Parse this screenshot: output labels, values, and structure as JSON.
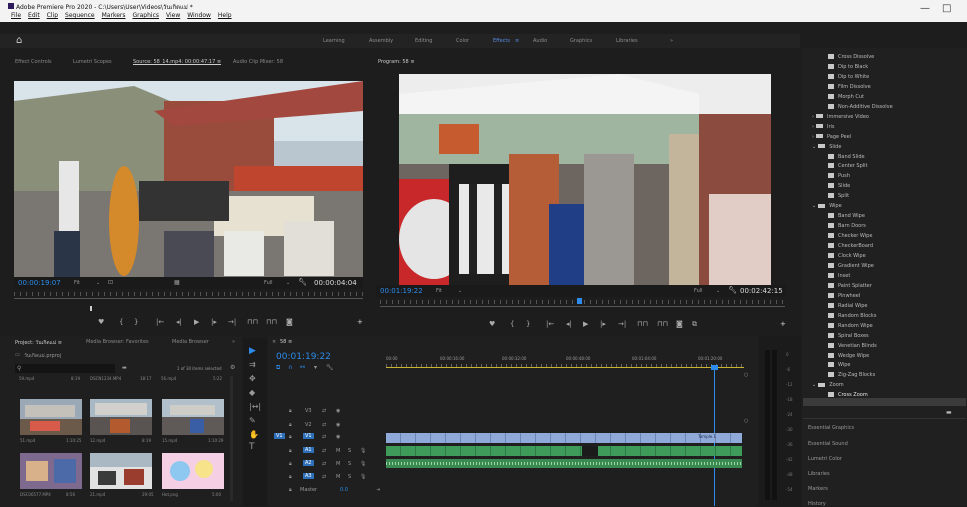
{
  "titlebar": {
    "title": "Adobe Premiere Pro 2020 - C:\\Users\\User\\Videos\\วันเกิดแม่ *",
    "menus": [
      "File",
      "Edit",
      "Clip",
      "Sequence",
      "Markers",
      "Graphics",
      "View",
      "Window",
      "Help"
    ],
    "minimize": "—",
    "restore": "□"
  },
  "header": {
    "home_icon": "home-icon",
    "workspaces": [
      "Learning",
      "Assembly",
      "Editing",
      "Color",
      "Effects",
      "Audio",
      "Graphics",
      "Libraries"
    ],
    "active_workspace": "Effects",
    "more": "»"
  },
  "source_monitor": {
    "tabs": [
      "Effect Controls",
      "Lumetri Scopes",
      "Source: 58_14.mp4: 00:00:47:17  ≡",
      "Audio Clip Mixer: 58"
    ],
    "timecode": "00:00:19:07",
    "fit": "Fit",
    "quality": "Full",
    "duration": "00:00:04:04"
  },
  "program_monitor": {
    "tab": "Program: 58  ≡",
    "timecode": "00:01:19:22",
    "fit": "Fit",
    "quality": "Full",
    "duration": "00:02:42:15"
  },
  "transport_icons": [
    "marker",
    "in-point",
    "out-point",
    "go-to-in",
    "step-back",
    "play",
    "step-forward",
    "go-to-out",
    "insert",
    "overwrite",
    "export-frame"
  ],
  "transport_glyphs": [
    "♥",
    "{",
    "}",
    "|←",
    "◂|",
    "▶",
    "|▸",
    "→|",
    "⊓⊓",
    "⊓⊓",
    "◙"
  ],
  "project_panel": {
    "tabs": [
      "Project: วันเกิดแม่ ≡",
      "Media Browser: Favorites",
      "Media Browser",
      "»"
    ],
    "project_file": "วันเกิดแม่.prproj",
    "items_selected": "1 of 30 items selected",
    "row1": [
      "59.mp4",
      "8:19",
      "DSCN1234.MP4",
      "18:17",
      "56.mp4",
      "5:22"
    ],
    "thumbs": [
      {
        "name": "51.mp4",
        "dur": "1:10:25"
      },
      {
        "name": "12.mp4",
        "dur": "8:19"
      },
      {
        "name": "15.mp4",
        "dur": "1:10:29"
      },
      {
        "name": "DSC06577.MP4",
        "dur": "8:56"
      },
      {
        "name": "21.mp4",
        "dur": "29:05"
      },
      {
        "name": "Hot.png",
        "dur": "5:00"
      }
    ]
  },
  "timeline": {
    "tab": "58  ≡",
    "timecode": "00:01:19:22",
    "ruler_labels": [
      "00:00",
      "00:00:16:00",
      "00:00:32:00",
      "00:00:48:00",
      "00:01:04:00",
      "00:01:20:00"
    ],
    "tracks": [
      {
        "name": "V3",
        "kind": "video"
      },
      {
        "name": "V2",
        "kind": "video"
      },
      {
        "name": "V1",
        "kind": "video"
      },
      {
        "name": "A1",
        "kind": "audio"
      },
      {
        "name": "A2",
        "kind": "audio"
      },
      {
        "name": "A3",
        "kind": "audio"
      }
    ],
    "master_label": "Master",
    "master_value": "0.0",
    "source_patch": "V1",
    "clip_label": "Temple.1",
    "m_label": "M",
    "s_label": "S",
    "vu_scale": [
      "0",
      "-6",
      "-12",
      "-18",
      "-24",
      "-30",
      "-36",
      "-42",
      "-48",
      "-54"
    ]
  },
  "effects_panel": {
    "items": [
      {
        "type": "effect",
        "label": "Cross Dissolve"
      },
      {
        "type": "effect",
        "label": "Dip to Black"
      },
      {
        "type": "effect",
        "label": "Dip to White"
      },
      {
        "type": "effect",
        "label": "Film Dissolve"
      },
      {
        "type": "effect",
        "label": "Morph Cut"
      },
      {
        "type": "effect",
        "label": "Non-Additive Dissolve"
      },
      {
        "type": "folder",
        "label": "Immersive Video",
        "expanded": false
      },
      {
        "type": "folder",
        "label": "Iris",
        "expanded": false
      },
      {
        "type": "folder",
        "label": "Page Peel",
        "expanded": false
      },
      {
        "type": "folder",
        "label": "Slide",
        "expanded": true
      },
      {
        "type": "effect",
        "label": "Band Slide"
      },
      {
        "type": "effect",
        "label": "Center Split"
      },
      {
        "type": "effect",
        "label": "Push"
      },
      {
        "type": "effect",
        "label": "Slide"
      },
      {
        "type": "effect",
        "label": "Split"
      },
      {
        "type": "folder",
        "label": "Wipe",
        "expanded": true
      },
      {
        "type": "effect",
        "label": "Band Wipe"
      },
      {
        "type": "effect",
        "label": "Barn Doors"
      },
      {
        "type": "effect",
        "label": "Checker Wipe"
      },
      {
        "type": "effect",
        "label": "CheckerBoard"
      },
      {
        "type": "effect",
        "label": "Clock Wipe"
      },
      {
        "type": "effect",
        "label": "Gradient Wipe"
      },
      {
        "type": "effect",
        "label": "Inset"
      },
      {
        "type": "effect",
        "label": "Paint Splatter"
      },
      {
        "type": "effect",
        "label": "Pinwheel"
      },
      {
        "type": "effect",
        "label": "Radial Wipe"
      },
      {
        "type": "effect",
        "label": "Random Blocks"
      },
      {
        "type": "effect",
        "label": "Random Wipe"
      },
      {
        "type": "effect",
        "label": "Spiral Boxes"
      },
      {
        "type": "effect",
        "label": "Venetian Blinds"
      },
      {
        "type": "effect",
        "label": "Wedge Wipe"
      },
      {
        "type": "effect",
        "label": "Wipe"
      },
      {
        "type": "effect",
        "label": "Zig-Zag Blocks"
      },
      {
        "type": "folder",
        "label": "Zoom",
        "expanded": true
      },
      {
        "type": "effect",
        "label": "Cross Zoom",
        "selected": true
      }
    ],
    "side_panels": [
      "Essential Graphics",
      "Essential Sound",
      "Lumetri Color",
      "Libraries",
      "Markers",
      "History"
    ]
  },
  "colors": {
    "accent": "#2d8ceb",
    "clip_video": "#8fa9d8",
    "clip_audio": "#3f9b5a",
    "selected_effect": "#3b3b3b"
  }
}
